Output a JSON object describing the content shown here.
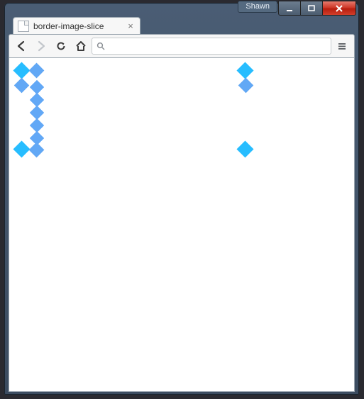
{
  "window": {
    "user_badge": "Shawn"
  },
  "browser": {
    "tab_title": "border-image-slice",
    "address_value": ""
  }
}
